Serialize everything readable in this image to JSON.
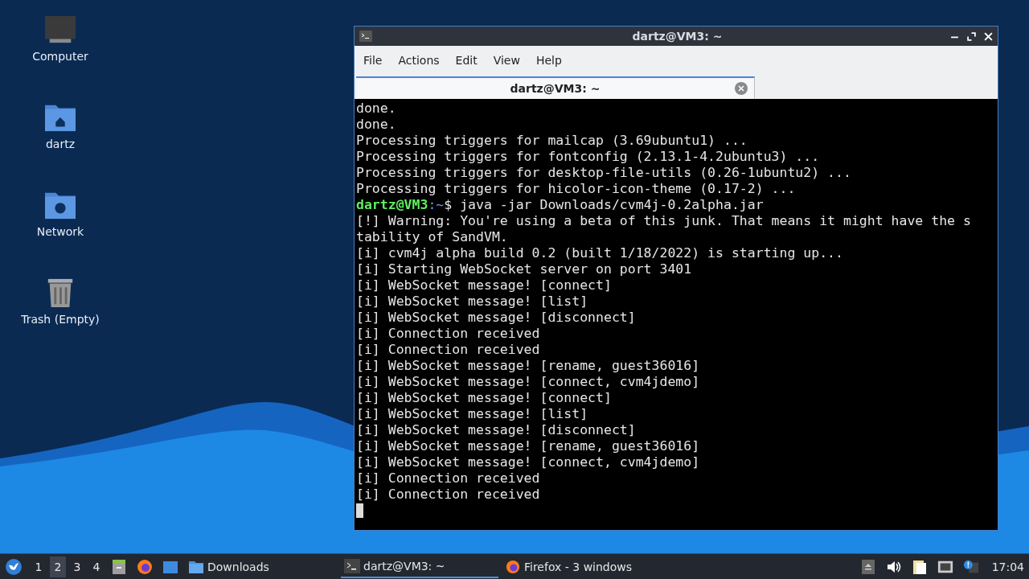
{
  "desktop_icons": [
    {
      "kind": "computer",
      "label": "Computer"
    },
    {
      "kind": "home",
      "label": "dartz"
    },
    {
      "kind": "network",
      "label": "Network"
    },
    {
      "kind": "trash",
      "label": "Trash (Empty)"
    }
  ],
  "window": {
    "title": "dartz@VM3: ~",
    "menu": [
      "File",
      "Actions",
      "Edit",
      "View",
      "Help"
    ],
    "tabs": [
      {
        "label": "dartz@VM3: ~",
        "selected": true
      }
    ],
    "lines": [
      {
        "kind": "output",
        "text": "done."
      },
      {
        "kind": "output",
        "text": "done."
      },
      {
        "kind": "output",
        "text": "Processing triggers for mailcap (3.69ubuntu1) ..."
      },
      {
        "kind": "output",
        "text": "Processing triggers for fontconfig (2.13.1-4.2ubuntu3) ..."
      },
      {
        "kind": "output",
        "text": "Processing triggers for desktop-file-utils (0.26-1ubuntu2) ..."
      },
      {
        "kind": "output",
        "text": "Processing triggers for hicolor-icon-theme (0.17-2) ..."
      },
      {
        "kind": "prompt",
        "user": "dartz@VM3",
        "path": ":~",
        "text": "$ java -jar Downloads/cvm4j-0.2alpha.jar"
      },
      {
        "kind": "output",
        "text": "[!] Warning: You're using a beta of this junk. That means it might have the s"
      },
      {
        "kind": "output",
        "text": "tability of SandVM."
      },
      {
        "kind": "output",
        "text": "[i] cvm4j alpha build 0.2 (built 1/18/2022) is starting up..."
      },
      {
        "kind": "output",
        "text": "[i] Starting WebSocket server on port 3401"
      },
      {
        "kind": "output",
        "text": "[i] WebSocket message! [connect]"
      },
      {
        "kind": "output",
        "text": "[i] WebSocket message! [list]"
      },
      {
        "kind": "output",
        "text": "[i] WebSocket message! [disconnect]"
      },
      {
        "kind": "output",
        "text": "[i] Connection received"
      },
      {
        "kind": "output",
        "text": "[i] Connection received"
      },
      {
        "kind": "output",
        "text": "[i] WebSocket message! [rename, guest36016]"
      },
      {
        "kind": "output",
        "text": "[i] WebSocket message! [connect, cvm4jdemo]"
      },
      {
        "kind": "output",
        "text": "[i] WebSocket message! [connect]"
      },
      {
        "kind": "output",
        "text": "[i] WebSocket message! [list]"
      },
      {
        "kind": "output",
        "text": "[i] WebSocket message! [disconnect]"
      },
      {
        "kind": "output",
        "text": "[i] WebSocket message! [rename, guest36016]"
      },
      {
        "kind": "output",
        "text": "[i] WebSocket message! [connect, cvm4jdemo]"
      },
      {
        "kind": "output",
        "text": "[i] Connection received"
      },
      {
        "kind": "output",
        "text": "[i] Connection received"
      }
    ]
  },
  "taskbar": {
    "workspaces": [
      {
        "label": "1",
        "selected": false
      },
      {
        "label": "2",
        "selected": true
      },
      {
        "label": "3",
        "selected": false
      },
      {
        "label": "4",
        "selected": false
      }
    ],
    "launchers": [
      {
        "kind": "files"
      },
      {
        "kind": "firefox"
      },
      {
        "kind": "desktop"
      }
    ],
    "tasks": [
      {
        "kind": "folder",
        "label": "Downloads",
        "selected": false
      },
      {
        "kind": "terminal",
        "label": "dartz@VM3: ~",
        "selected": true
      },
      {
        "kind": "firefox",
        "label": "Firefox - 3 windows",
        "selected": false
      }
    ],
    "tray": [
      {
        "kind": "eject"
      },
      {
        "kind": "volume"
      },
      {
        "kind": "clipboard"
      },
      {
        "kind": "network"
      },
      {
        "kind": "update"
      }
    ],
    "clock": "17:04"
  }
}
